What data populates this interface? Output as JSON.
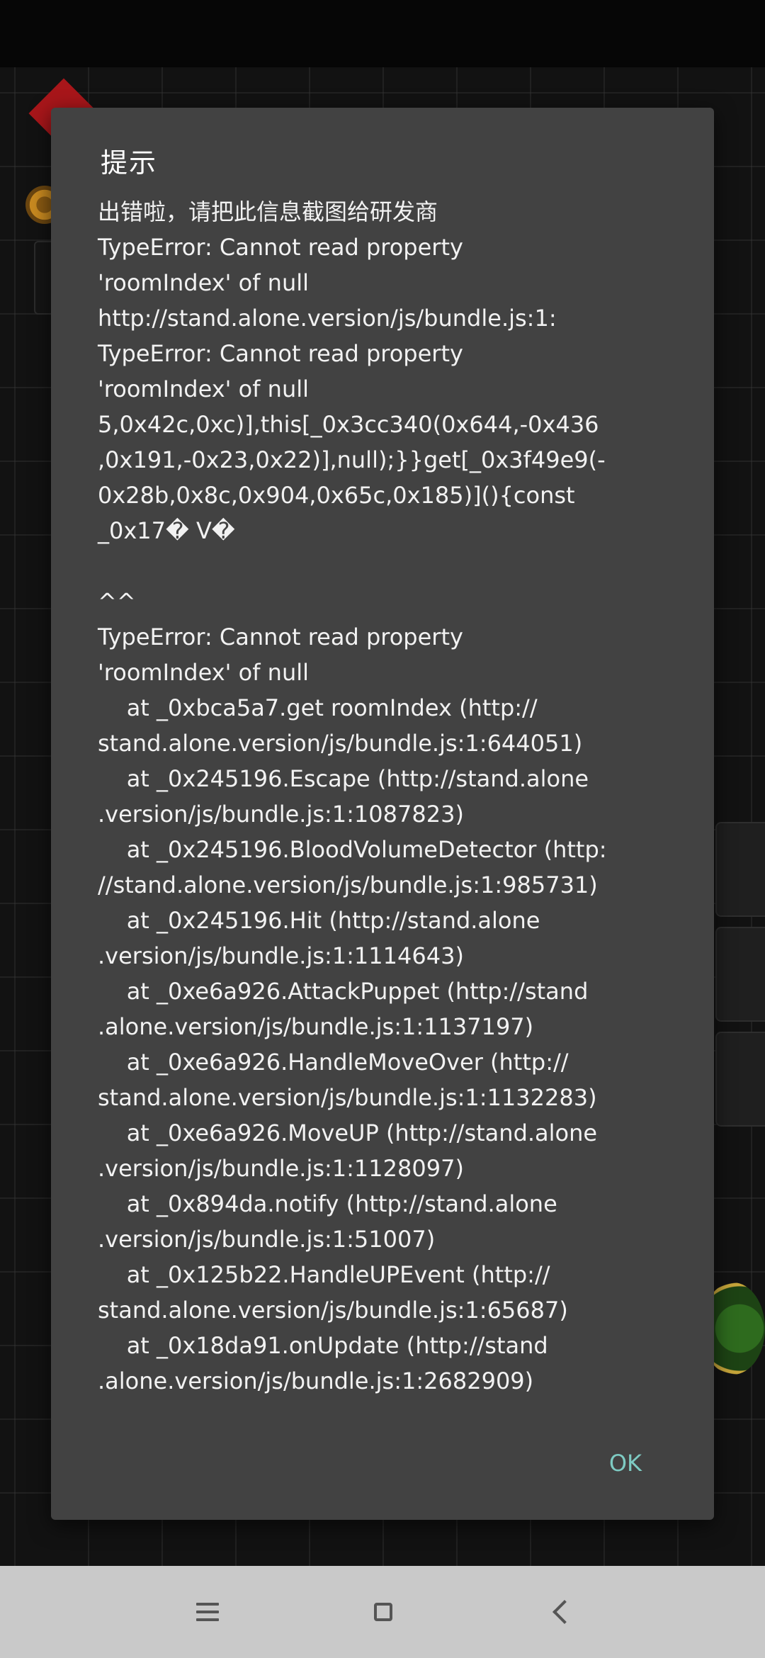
{
  "dialog": {
    "title": "提示",
    "message": "出错啦，请把此信息截图给研发商\nTypeError: Cannot read property\n'roomIndex' of null\nhttp://stand.alone.version/js/bundle.js:1:\nTypeError: Cannot read property\n'roomIndex' of null\n5,0x42c,0xc)],this[_0x3cc340(0x644,-0x436\n,0x191,-0x23,0x22)],null);}}get[_0x3f49e9(-\n0x28b,0x8c,0x904,0x65c,0x185)](){const\n_0x17� V�\n\n^^\nTypeError: Cannot read property\n'roomIndex' of null\n    at _0xbca5a7.get roomIndex (http://\nstand.alone.version/js/bundle.js:1:644051)\n    at _0x245196.Escape (http://stand.alone\n.version/js/bundle.js:1:1087823)\n    at _0x245196.BloodVolumeDetector (http:\n//stand.alone.version/js/bundle.js:1:985731)\n    at _0x245196.Hit (http://stand.alone\n.version/js/bundle.js:1:1114643)\n    at _0xe6a926.AttackPuppet (http://stand\n.alone.version/js/bundle.js:1:1137197)\n    at _0xe6a926.HandleMoveOver (http://\nstand.alone.version/js/bundle.js:1:1132283)\n    at _0xe6a926.MoveUP (http://stand.alone\n.version/js/bundle.js:1:1128097)\n    at _0x894da.notify (http://stand.alone\n.version/js/bundle.js:1:51007)\n    at _0x125b22.HandleUPEvent (http://\nstand.alone.version/js/bundle.js:1:65687)\n    at _0x18da91.onUpdate (http://stand\n.alone.version/js/bundle.js:1:2682909)",
    "ok_label": "OK"
  },
  "nav_bar": {
    "menu_icon": "menu-icon",
    "home_icon": "square-home-icon",
    "back_icon": "back-chevron-icon"
  },
  "colors": {
    "dialog_background": "#424242",
    "dialog_text": "#f2f2f2",
    "ok_accent": "#7ecbc3",
    "nav_bar_background": "#c9c9c9",
    "nav_icon": "#555555"
  }
}
